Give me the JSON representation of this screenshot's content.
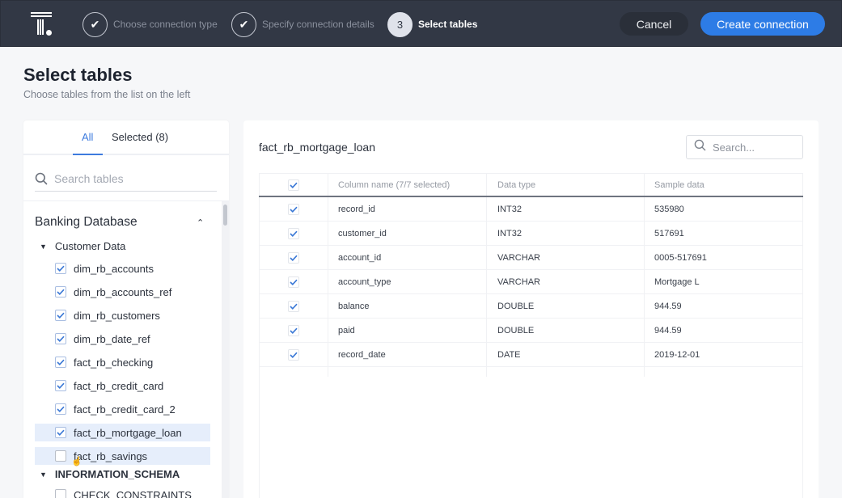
{
  "header": {
    "logo": "thoughtspot-logo",
    "steps": [
      {
        "label": "Choose connection type",
        "state": "complete",
        "icon": "check-icon"
      },
      {
        "label": "Specify connection details",
        "state": "complete",
        "icon": "check-icon"
      },
      {
        "label": "Select tables",
        "state": "active",
        "number": "3"
      }
    ],
    "cancel_label": "Cancel",
    "create_label": "Create connection",
    "accent_color": "#2d7ce6"
  },
  "page": {
    "title": "Select tables",
    "subtitle": "Choose tables from the list on the left"
  },
  "left_panel": {
    "tabs": [
      {
        "label": "All",
        "active": true
      },
      {
        "label": "Selected (8)",
        "active": false
      }
    ],
    "search_placeholder": "Search tables",
    "database": "Banking Database",
    "groups": [
      {
        "name": "Customer Data",
        "items": [
          {
            "name": "dim_rb_accounts",
            "checked": true
          },
          {
            "name": "dim_rb_accounts_ref",
            "checked": true
          },
          {
            "name": "dim_rb_customers",
            "checked": true
          },
          {
            "name": "dim_rb_date_ref",
            "checked": true
          },
          {
            "name": "fact_rb_checking",
            "checked": true
          },
          {
            "name": "fact_rb_credit_card",
            "checked": true
          },
          {
            "name": "fact_rb_credit_card_2",
            "checked": true
          },
          {
            "name": "fact_rb_mortgage_loan",
            "checked": true,
            "highlighted": true
          },
          {
            "name": "fact_rb_savings",
            "checked": false,
            "hovered": true
          }
        ]
      },
      {
        "name": "INFORMATION_SCHEMA",
        "items": [
          {
            "name": "CHECK_CONSTRAINTS",
            "checked": false
          }
        ]
      }
    ]
  },
  "right_panel": {
    "table_name": "fact_rb_mortgage_loan",
    "search_placeholder": "Search...",
    "columns_header": [
      "Column name (7/7 selected)",
      "Data type",
      "Sample data"
    ],
    "rows": [
      {
        "name": "record_id",
        "type": "INT32",
        "sample": "535980",
        "checked": true
      },
      {
        "name": "customer_id",
        "type": "INT32",
        "sample": "517691",
        "checked": true
      },
      {
        "name": "account_id",
        "type": "VARCHAR",
        "sample": "0005-517691",
        "checked": true
      },
      {
        "name": "account_type",
        "type": "VARCHAR",
        "sample": "Mortgage L",
        "checked": true
      },
      {
        "name": "balance",
        "type": "DOUBLE",
        "sample": "944.59",
        "checked": true
      },
      {
        "name": "paid",
        "type": "DOUBLE",
        "sample": "944.59",
        "checked": true
      },
      {
        "name": "record_date",
        "type": "DATE",
        "sample": "2019-12-01",
        "checked": true
      }
    ]
  }
}
